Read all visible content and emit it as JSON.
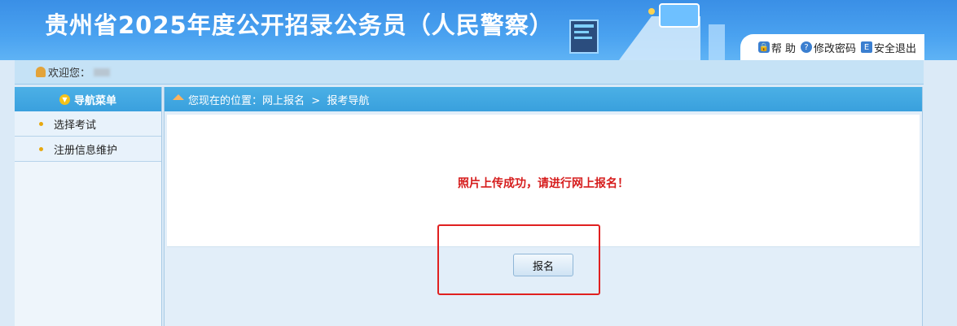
{
  "header": {
    "title": "贵州省2025年度公开招录公务员（人民警察）"
  },
  "toolbar": {
    "help": "帮 助",
    "change_password": "修改密码",
    "logout": "安全退出"
  },
  "welcome": {
    "label": "欢迎您："
  },
  "nav": {
    "title": "导航菜单",
    "items": [
      {
        "label": "选择考试"
      },
      {
        "label": "注册信息维护"
      }
    ]
  },
  "breadcrumb": {
    "text": "您现在的位置：网上报名  >  报考导航"
  },
  "main": {
    "message": "照片上传成功，请进行网上报名！",
    "register_button": "报名"
  },
  "colors": {
    "header": "#3a8fe6",
    "accent_bar": "#3aa0de",
    "message": "#d61c1c",
    "highlight_box": "#e02020"
  }
}
